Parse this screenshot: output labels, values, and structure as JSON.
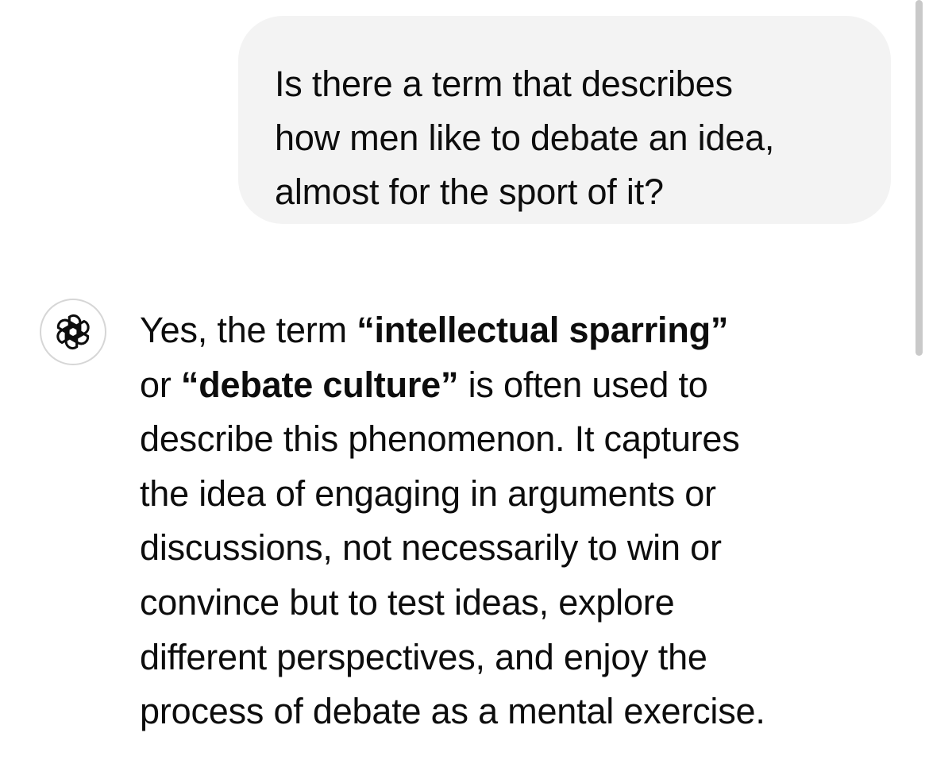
{
  "user_message": {
    "lines": [
      "Is there a term that describes",
      "how men like to debate an idea,",
      "almost for the sport of it?"
    ]
  },
  "assistant": {
    "avatar_icon": "openai-logo-icon",
    "line1_pre": "Yes, the term ",
    "line1_bold": "“intellectual sparring”",
    "line2_pre": "or ",
    "line2_bold": "“debate culture”",
    "line2_post": " is often used to",
    "lines_rest": [
      "describe this phenomenon. It captures",
      "the idea of engaging in arguments or",
      "discussions, not necessarily to win or",
      "convince but to test ideas, explore",
      "different perspectives, and enjoy the",
      "process of debate as a mental exercise."
    ]
  },
  "colors": {
    "bubble_bg": "#f3f3f3",
    "text": "#0d0d0d",
    "avatar_border": "#d6d6d6",
    "scrollbar": "#c9c9c9"
  }
}
